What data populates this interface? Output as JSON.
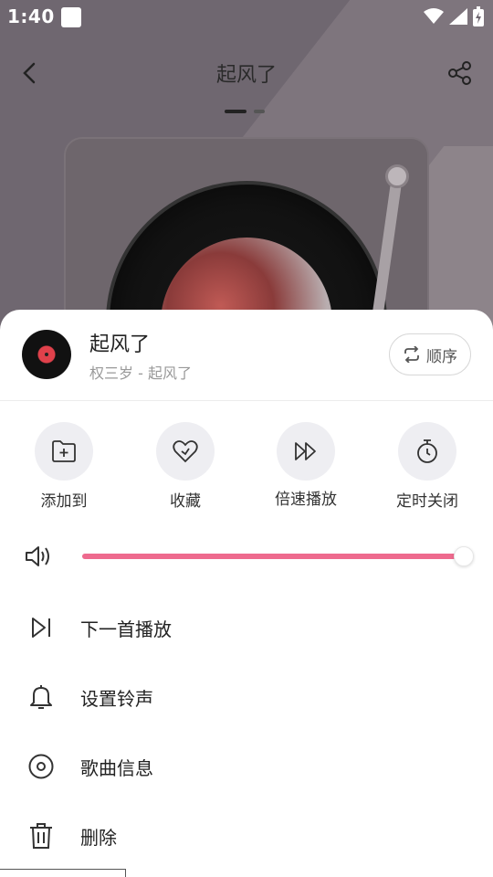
{
  "status": {
    "time": "1:40"
  },
  "player": {
    "title": "起风了"
  },
  "sheet": {
    "song_name": "起风了",
    "song_meta": "权三岁 - 起风了",
    "order_label": "顺序",
    "actions": [
      {
        "label": "添加到",
        "icon": "add-to-folder-icon"
      },
      {
        "label": "收藏",
        "icon": "heart-icon"
      },
      {
        "label": "倍速播放",
        "icon": "fast-forward-icon"
      },
      {
        "label": "定时关闭",
        "icon": "timer-icon"
      }
    ],
    "volume": {
      "level": 1.0
    },
    "menu": [
      {
        "label": "下一首播放",
        "icon": "play-next-icon"
      },
      {
        "label": "设置铃声",
        "icon": "bell-icon"
      },
      {
        "label": "歌曲信息",
        "icon": "disc-info-icon"
      },
      {
        "label": "删除",
        "icon": "trash-icon"
      }
    ]
  },
  "colors": {
    "accent": "#ee6a8e",
    "action_bg": "#eeeef2"
  }
}
